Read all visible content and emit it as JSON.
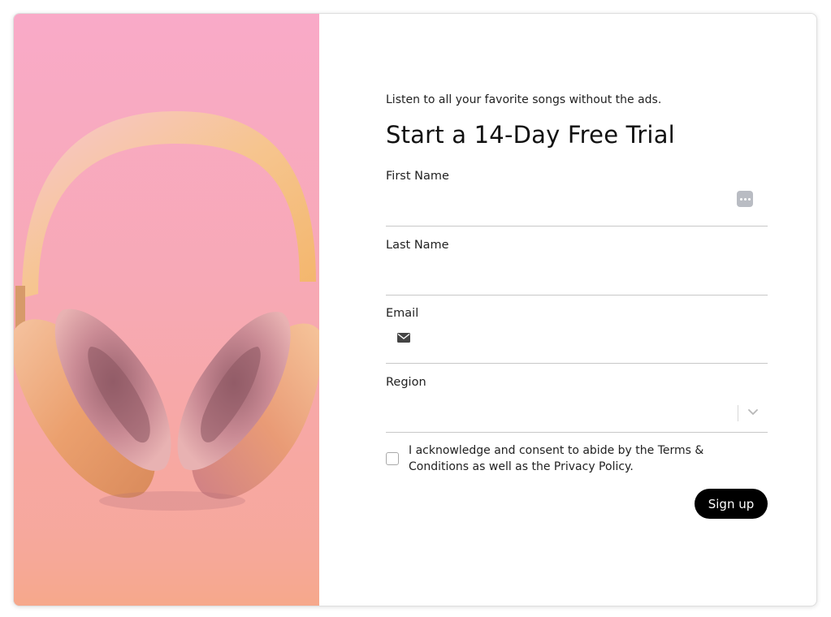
{
  "form": {
    "tagline": "Listen to all your favorite songs without the ads.",
    "title": "Start a 14-Day Free Trial",
    "fields": {
      "first_name": {
        "label": "First Name",
        "value": ""
      },
      "last_name": {
        "label": "Last Name",
        "value": ""
      },
      "email": {
        "label": "Email",
        "value": "",
        "icon": "mail-icon"
      },
      "region": {
        "label": "Region",
        "selected": "",
        "icon": "chevron-down-icon"
      }
    },
    "consent": "I acknowledge and consent to abide by the Terms & Conditions as well as the Privacy Policy.",
    "consent_checked": false,
    "signup_label": "Sign up"
  },
  "colors": {
    "accent": "#000000",
    "hero_top": "#f9aac8",
    "hero_bottom": "#f6a890"
  }
}
